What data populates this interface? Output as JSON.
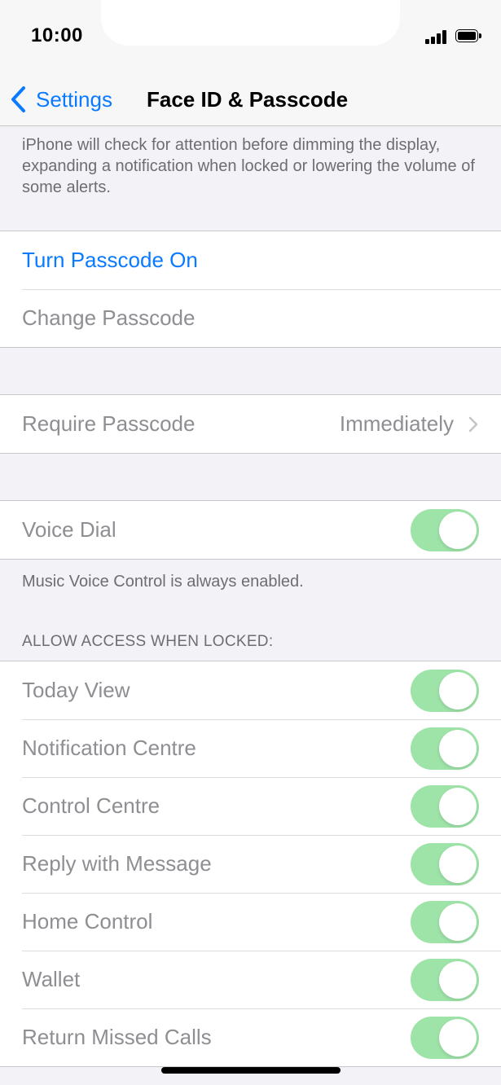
{
  "status_bar": {
    "time": "10:00"
  },
  "nav": {
    "back_label": "Settings",
    "title": "Face ID & Passcode"
  },
  "attention_footer": "iPhone will check for attention before dimming the display, expanding a notification when locked or lowering the volume of some alerts.",
  "passcode_group": {
    "turn_on": "Turn Passcode On",
    "change": "Change Passcode"
  },
  "require_passcode": {
    "label": "Require Passcode",
    "value": "Immediately"
  },
  "voice_dial": {
    "label": "Voice Dial",
    "enabled": true,
    "footer": "Music Voice Control is always enabled."
  },
  "locked_access": {
    "header": "ALLOW ACCESS WHEN LOCKED:",
    "items": [
      {
        "label": "Today View",
        "enabled": true
      },
      {
        "label": "Notification Centre",
        "enabled": true
      },
      {
        "label": "Control Centre",
        "enabled": true
      },
      {
        "label": "Reply with Message",
        "enabled": true
      },
      {
        "label": "Home Control",
        "enabled": true
      },
      {
        "label": "Wallet",
        "enabled": true
      },
      {
        "label": "Return Missed Calls",
        "enabled": true
      }
    ]
  },
  "colors": {
    "accent": "#0a7aff",
    "toggle_on": "#9ee3a8",
    "background": "#f2f2f7"
  }
}
